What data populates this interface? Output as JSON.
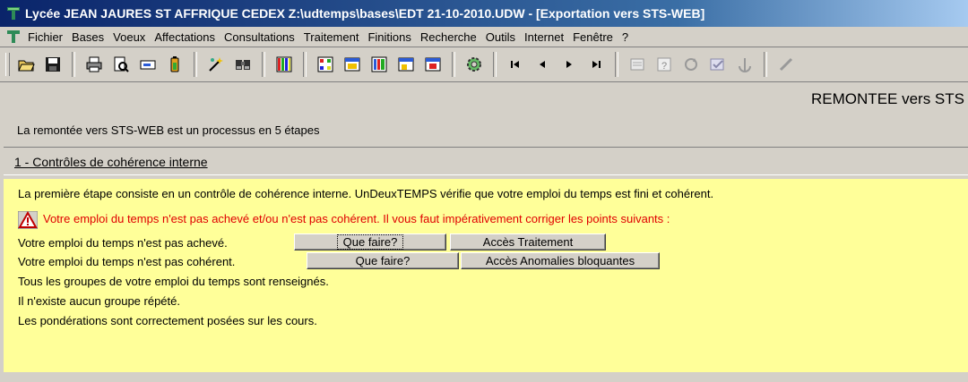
{
  "window": {
    "title": "Lycée JEAN JAURES  ST AFFRIQUE CEDEX   Z:\\udtemps\\bases\\EDT 21-10-2010.UDW - [Exportation vers STS-WEB]"
  },
  "menu": [
    "Fichier",
    "Bases",
    "Voeux",
    "Affectations",
    "Consultations",
    "Traitement",
    "Finitions",
    "Recherche",
    "Outils",
    "Internet",
    "Fenêtre",
    "?"
  ],
  "toolbar_icons": [
    "open-folder-icon",
    "save-icon",
    "print-icon",
    "print-preview-icon",
    "export-icon",
    "battery-icon",
    "wand-icon",
    "binoculars-icon",
    "grid-colors-icon",
    "grid-icon",
    "grid-yellow-icon",
    "grid-red-icon",
    "grid-select-icon",
    "grid-alt-icon",
    "gear-icon",
    "first-record-icon",
    "prev-record-icon",
    "next-record-icon",
    "last-record-icon",
    "document-icon",
    "help-icon",
    "refresh-icon",
    "check-icon",
    "anchor-icon",
    "pen-icon"
  ],
  "page": {
    "title": "REMONTEE vers STS",
    "intro": "La remontée vers STS-WEB est un processus en 5 étapes",
    "step_title": "1 - Contrôles de cohérence interne"
  },
  "panel": {
    "description": "La première étape consiste en un contrôle de cohérence interne. UnDeuxTEMPS vérifie que votre emploi du temps est fini et cohérent.",
    "warning": "Votre emploi du temps n'est pas achevé et/ou n'est pas cohérent. Il vous faut impérativement corriger les points suivants :",
    "row1_label": "Votre emploi du temps n'est pas achevé.",
    "row1_btn_what": "Que faire?",
    "row1_btn_access": "Accès Traitement",
    "row2_label": "Votre emploi du temps n'est pas cohérent.",
    "row2_btn_what": "Que faire?",
    "row2_btn_access": "Accès Anomalies bloquantes",
    "line3": "Tous les groupes de votre emploi du temps sont renseignés.",
    "line4": "Il n'existe aucun groupe répété.",
    "line5": "Les pondérations sont correctement posées sur les cours."
  },
  "colors": {
    "panel_bg": "#ffff99",
    "warning": "#e00000",
    "title_bar": "#0a246a"
  }
}
